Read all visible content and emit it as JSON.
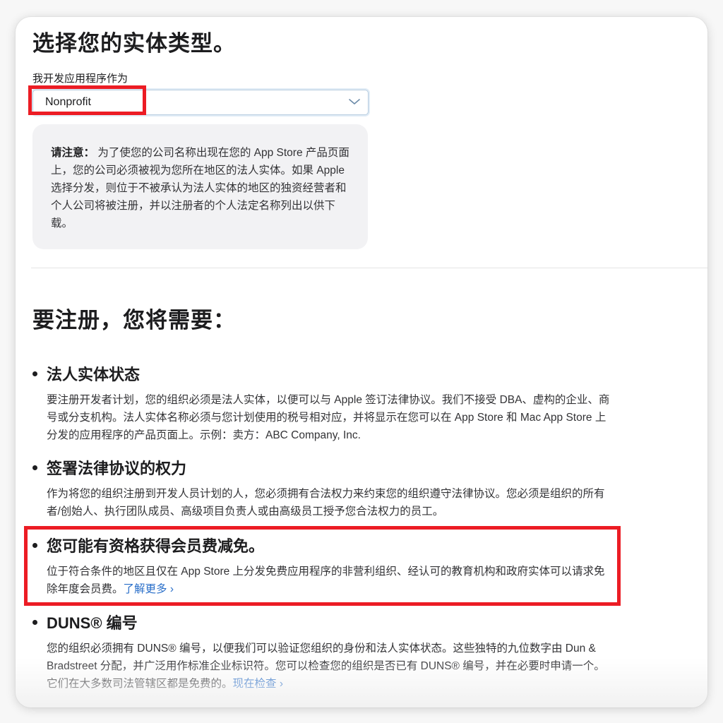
{
  "entity_section": {
    "title": "选择您的实体类型。",
    "field_label": "我开发应用程序作为",
    "select": {
      "value": "Nonprofit",
      "icon": "chevron-down-icon"
    },
    "note": {
      "label": "请注意：",
      "text": "为了使您的公司名称出现在您的 App Store 产品页面上，您的公司必须被视为您所在地区的法人实体。如果 Apple 选择分发，则位于不被承认为法人实体的地区的独资经营者和个人公司将被注册，并以注册者的个人法定名称列出以供下载。"
    }
  },
  "requirements_section": {
    "title": "要注册，您将需要：",
    "items": [
      {
        "heading": "法人实体状态",
        "body": "要注册开发者计划，您的组织必须是法人实体，以便可以与 Apple 签订法律协议。我们不接受 DBA、虚构的企业、商号或分支机构。法人实体名称必须与您计划使用的税号相对应，并将显示在您可以在 App Store 和 Mac App Store 上分发的应用程序的产品页面上。示例：卖方：ABC Company, Inc."
      },
      {
        "heading": "签署法律协议的权力",
        "body": "作为将您的组织注册到开发人员计划的人，您必须拥有合法权力来约束您的组织遵守法律协议。您必须是组织的所有者/创始人、执行团队成员、高级项目负责人或由高级员工授予您合法权力的员工。"
      },
      {
        "heading": "您可能有资格获得会员费减免。",
        "body": "位于符合条件的地区且仅在 App Store 上分发免费应用程序的非营利组织、经认可的教育机构和政府实体可以请求免除年度会员费。",
        "link": "了解更多 ›"
      },
      {
        "heading": "DUNS® 编号",
        "body": "您的组织必须拥有 DUNS® 编号，以便我们可以验证您组织的身份和法人实体状态。这些独特的九位数字由 Dun & Bradstreet 分配，并广泛用作标准企业标识符。您可以检查您的组织是否已有 DUNS® 编号，并在必要时申请一个。它们在大多数司法管辖区都是免费的。",
        "link": "现在检查 ›"
      }
    ]
  },
  "annotations": {
    "highlight_color": "#ec1c24",
    "link_color": "#2a6fc9"
  }
}
